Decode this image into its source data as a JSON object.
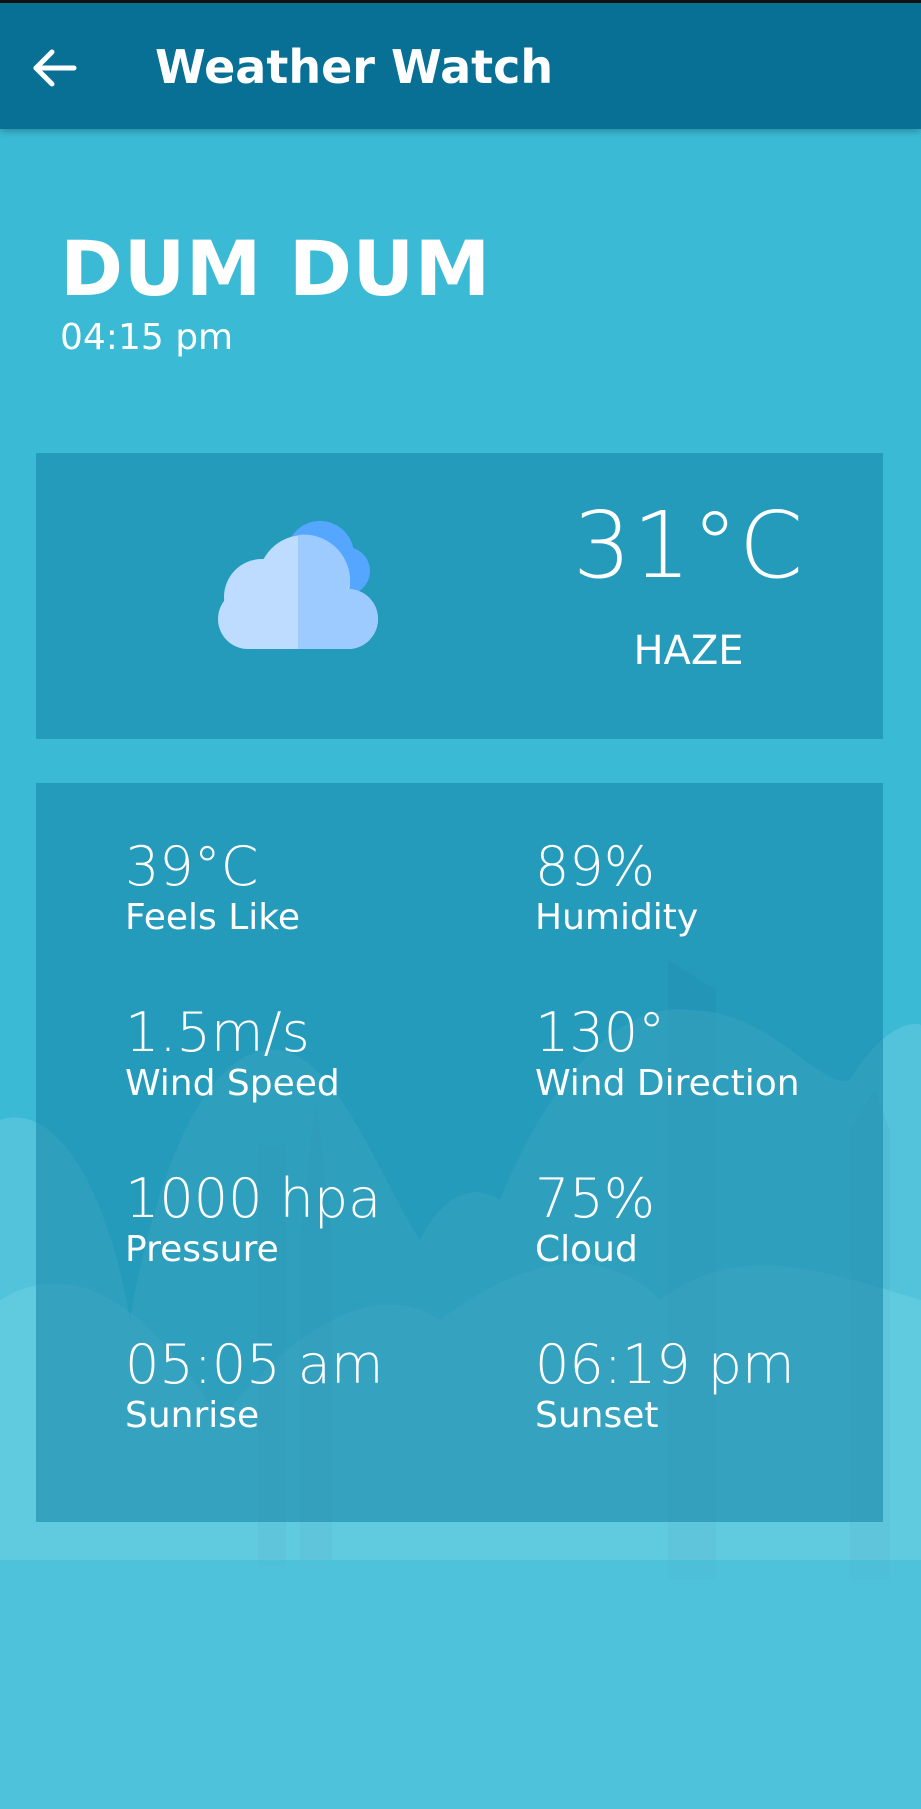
{
  "appbar": {
    "title": "Weather Watch",
    "back_icon": "arrow-left-icon"
  },
  "location": {
    "name": "DUM DUM",
    "time": "04:15 pm"
  },
  "current": {
    "temperature": "31°C",
    "condition": "HAZE",
    "icon": "cloud-icon"
  },
  "details": [
    {
      "value": "39°C",
      "label": "Feels Like"
    },
    {
      "value": "89%",
      "label": "Humidity"
    },
    {
      "value": "1.5m/s",
      "label": "Wind Speed"
    },
    {
      "value": "130°",
      "label": "Wind Direction"
    },
    {
      "value": "1000 hpa",
      "label": "Pressure"
    },
    {
      "value": "75%",
      "label": "Cloud"
    },
    {
      "value": "05:05 am",
      "label": "Sunrise"
    },
    {
      "value": "06:19 pm",
      "label": "Sunset"
    }
  ],
  "colors": {
    "appbar": "#087095",
    "background": "#3bbad5",
    "card": "#2496b8"
  }
}
